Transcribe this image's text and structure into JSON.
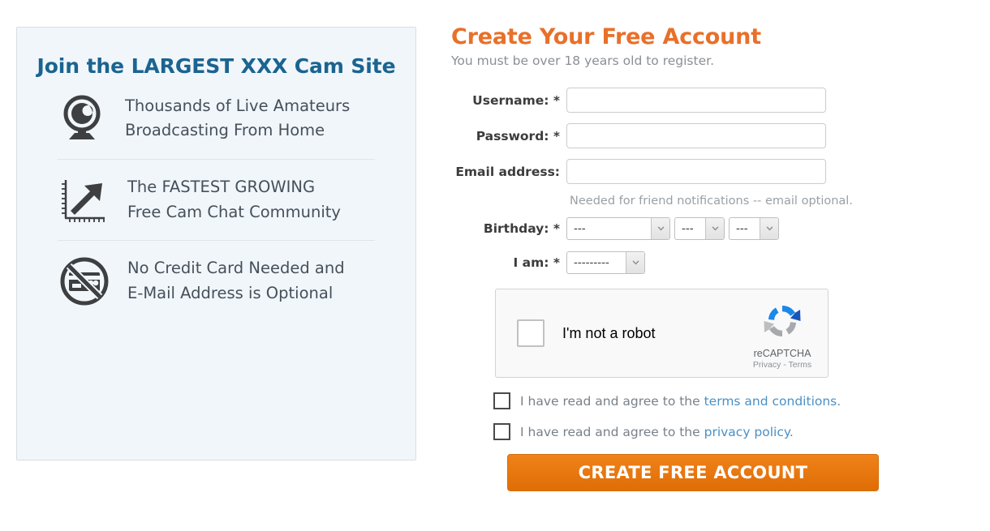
{
  "promo": {
    "title": "Join the LARGEST XXX Cam Site",
    "features": [
      {
        "icon": "webcam-icon",
        "line1": "Thousands of Live Amateurs",
        "line2": "Broadcasting From Home"
      },
      {
        "icon": "growth-chart-icon",
        "line1": "The FASTEST GROWING",
        "line2": "Free Cam Chat Community"
      },
      {
        "icon": "no-credit-card-icon",
        "line1": "No Credit Card Needed and",
        "line2": "E-Mail Address is Optional"
      }
    ]
  },
  "signup": {
    "title": "Create Your Free Account",
    "subtitle": "You must be over 18 years old to register.",
    "fields": {
      "username": {
        "label": "Username: *",
        "value": "",
        "placeholder": ""
      },
      "password": {
        "label": "Password: *",
        "value": "",
        "placeholder": ""
      },
      "email": {
        "label": "Email address:",
        "value": "",
        "placeholder": "",
        "helper": "Needed for friend notifications -- email optional."
      },
      "birthday": {
        "label": "Birthday: *",
        "year_value": "---",
        "month_value": "---",
        "day_value": "---",
        "options": [
          "---"
        ]
      },
      "gender": {
        "label": "I am: *",
        "value": "---------",
        "options": [
          "---------"
        ]
      }
    },
    "recaptcha": {
      "label": "I'm not a robot",
      "brand": "reCAPTCHA",
      "links": "Privacy - Terms",
      "checked": false
    },
    "consent": [
      {
        "prefix": "I have read and agree to the ",
        "link": "terms and conditions",
        "suffix": ".",
        "checked": false
      },
      {
        "prefix": "I have read and agree to the ",
        "link": "privacy policy",
        "suffix": ".",
        "checked": false
      }
    ],
    "submit_label": "CREATE FREE ACCOUNT"
  },
  "colors": {
    "promo_heading": "#1a6490",
    "signup_heading": "#e8702a",
    "link": "#4a90c4",
    "button": "#e8760d",
    "panel_bg": "#f1f6fa"
  }
}
